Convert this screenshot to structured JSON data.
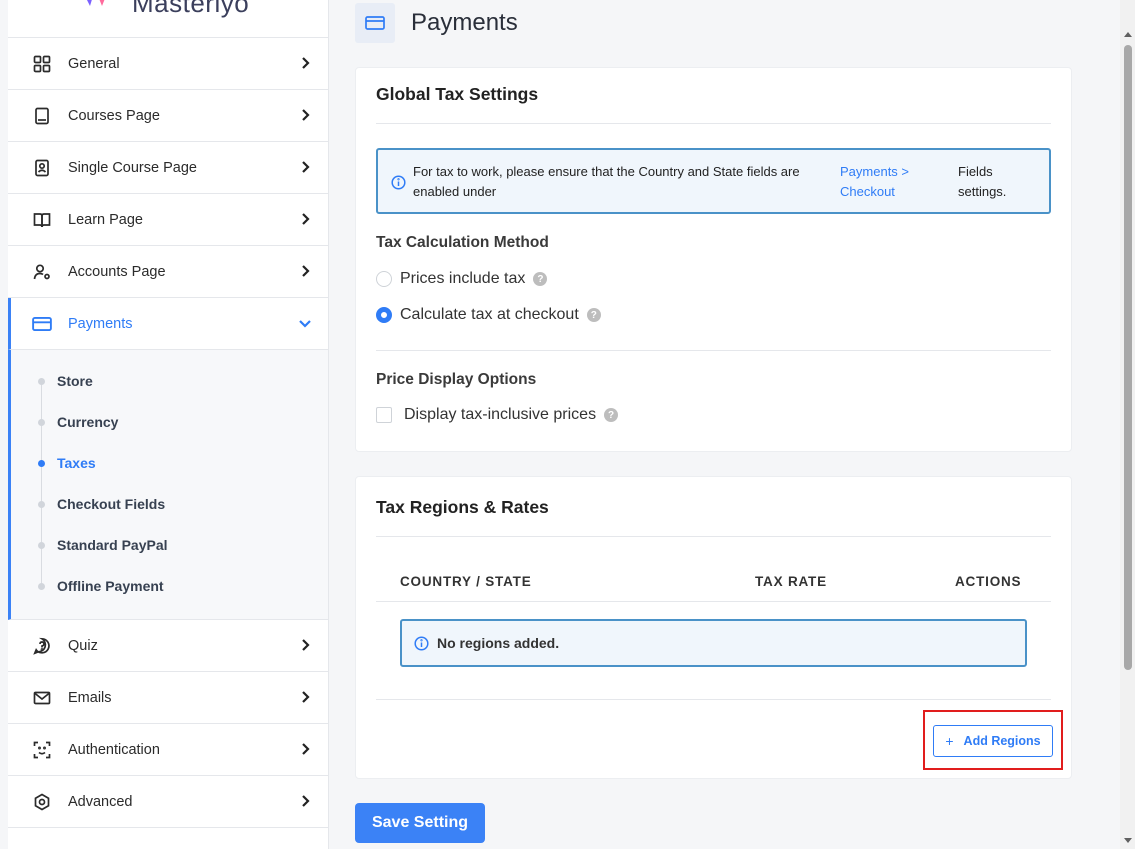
{
  "brand": {
    "logo_text": "Masteriyo"
  },
  "sidebar": {
    "items": [
      {
        "label": "General",
        "icon": "grid-icon"
      },
      {
        "label": "Courses Page",
        "icon": "book-icon"
      },
      {
        "label": "Single Course Page",
        "icon": "contact-book-icon"
      },
      {
        "label": "Learn Page",
        "icon": "open-book-icon"
      },
      {
        "label": "Accounts Page",
        "icon": "user-gear-icon"
      },
      {
        "label": "Payments",
        "icon": "credit-card-icon"
      },
      {
        "label": "Quiz",
        "icon": "chat-question-icon"
      },
      {
        "label": "Emails",
        "icon": "mail-icon"
      },
      {
        "label": "Authentication",
        "icon": "face-scan-icon"
      },
      {
        "label": "Advanced",
        "icon": "hex-gear-icon"
      }
    ],
    "active": "Payments",
    "subitems": [
      "Store",
      "Currency",
      "Taxes",
      "Checkout Fields",
      "Standard PayPal",
      "Offline Payment"
    ],
    "active_sub": "Taxes"
  },
  "page": {
    "title": "Payments"
  },
  "global_tax": {
    "title": "Global Tax Settings",
    "notice_text": "For tax to work, please ensure that the Country and State fields are enabled under",
    "notice_link": "Payments > Checkout",
    "notice_suffix": "Fields settings.",
    "calc_label": "Tax Calculation Method",
    "options": [
      "Prices include tax",
      "Calculate tax at checkout"
    ],
    "selected_option": "Calculate tax at checkout",
    "display_label": "Price Display Options",
    "display_checkbox": "Display tax-inclusive prices",
    "display_checked": false
  },
  "regions": {
    "title": "Tax Regions & Rates",
    "columns": [
      "COUNTRY / STATE",
      "TAX RATE",
      "ACTIONS"
    ],
    "empty_text": "No regions added.",
    "add_label": "Add Regions"
  },
  "save_label": "Save Setting",
  "colors": {
    "accent": "#2f7cf6",
    "highlight": "#e11d1d"
  }
}
